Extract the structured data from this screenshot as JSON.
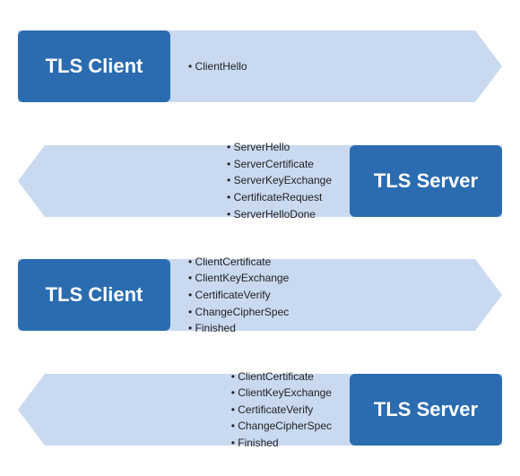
{
  "rows": [
    {
      "id": "row1",
      "direction": "right",
      "label": "TLS Client",
      "label_position": "left",
      "bullets": [
        "ClientHello"
      ]
    },
    {
      "id": "row2",
      "direction": "left",
      "label": "TLS Server",
      "label_position": "right",
      "bullets": [
        "ServerHello",
        "ServerCertificate",
        "ServerKeyExchange",
        "CertificateRequest",
        "ServerHelloDone"
      ]
    },
    {
      "id": "row3",
      "direction": "right",
      "label": "TLS Client",
      "label_position": "left",
      "bullets": [
        "ClientCertificate",
        "ClientKeyExchange",
        "CertificateVerify",
        "ChangeCipherSpec",
        "Finished"
      ]
    },
    {
      "id": "row4",
      "direction": "left",
      "label": "TLS Server",
      "label_position": "right",
      "bullets": [
        "ClientCertificate",
        "ClientKeyExchange",
        "CertificateVerify",
        "ChangeCipherSpec",
        "Finished"
      ]
    }
  ]
}
